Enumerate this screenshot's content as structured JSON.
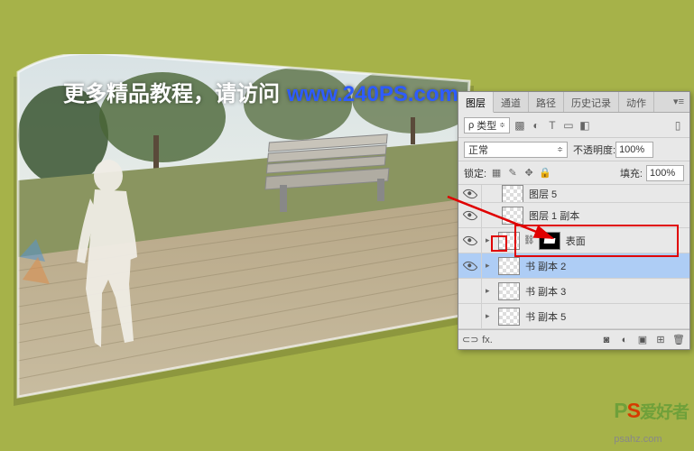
{
  "watermark": {
    "text_cn": "更多精品教程，请访问",
    "url": "www.240PS.com",
    "logo_p": "P",
    "logo_s": "S",
    "logo_cn": "爱好者",
    "logo_domain": "psahz.com"
  },
  "panel": {
    "tabs": [
      "图层",
      "通道",
      "路径",
      "历史记录",
      "动作"
    ],
    "active_tab": 0,
    "filter_kind": "类型",
    "blend_mode": "正常",
    "opacity_label": "不透明度:",
    "opacity_value": "100%",
    "lock_label": "锁定:",
    "fill_label": "填充:",
    "fill_value": "100%",
    "layers": [
      {
        "name": "图层 5",
        "visible": true,
        "indent": 1,
        "thumb": "checker",
        "collapsed": true
      },
      {
        "name": "图层 1 副本",
        "visible": true,
        "indent": 1,
        "thumb": "checker"
      },
      {
        "name": "表面",
        "visible": true,
        "indent": 0,
        "thumb": "checker",
        "mask": true
      },
      {
        "name": "书 副本 2",
        "visible": true,
        "indent": 0,
        "thumb": "checker",
        "selected": true
      },
      {
        "name": "书 副本 3",
        "visible": false,
        "indent": 0,
        "thumb": "checker"
      },
      {
        "name": "书 副本 5",
        "visible": false,
        "indent": 0,
        "thumb": "checker"
      }
    ],
    "bottom_fx": "fx."
  }
}
